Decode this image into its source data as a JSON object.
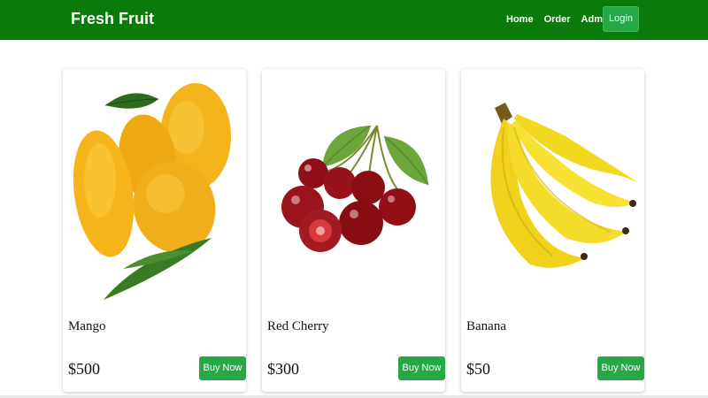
{
  "navbar": {
    "brand": "Fresh Fruit",
    "links": [
      "Home",
      "Order",
      "Admin"
    ],
    "login_label": "Login",
    "background_color": "#0a7a0a"
  },
  "products": [
    {
      "name": "Mango",
      "price": "$500",
      "button_label": "Buy Now",
      "image_icon": "mango-image"
    },
    {
      "name": "Red Cherry",
      "price": "$300",
      "button_label": "Buy Now",
      "image_icon": "cherry-image"
    },
    {
      "name": "Banana",
      "price": "$50",
      "button_label": "Buy Now",
      "image_icon": "banana-image"
    }
  ],
  "accent_color": "#27a847"
}
